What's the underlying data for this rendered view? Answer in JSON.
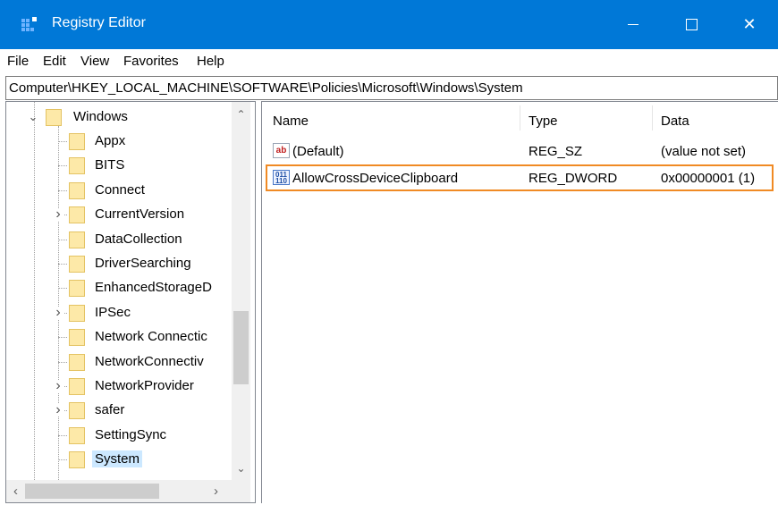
{
  "window": {
    "title": "Registry Editor",
    "accent_color": "#0078d7",
    "icons": [
      "registry-editor-icon",
      "minimize-icon",
      "maximize-icon",
      "close-icon"
    ],
    "close_glyph": "✕"
  },
  "menu": {
    "file": "File",
    "edit": "Edit",
    "view": "View",
    "favorites": "Favorites",
    "help": "Help"
  },
  "address": {
    "path": "Computer\\HKEY_LOCAL_MACHINE\\SOFTWARE\\Policies\\Microsoft\\Windows\\System"
  },
  "tree": {
    "parent": {
      "label": "Windows",
      "expander": "⌄"
    },
    "items": [
      {
        "label": "Appx",
        "expander": ""
      },
      {
        "label": "BITS",
        "expander": ""
      },
      {
        "label": "Connect",
        "expander": ""
      },
      {
        "label": "CurrentVersion",
        "expander": "›"
      },
      {
        "label": "DataCollection",
        "expander": ""
      },
      {
        "label": "DriverSearching",
        "expander": ""
      },
      {
        "label": "EnhancedStorageD",
        "expander": ""
      },
      {
        "label": "IPSec",
        "expander": "›"
      },
      {
        "label": "Network Connectic",
        "expander": ""
      },
      {
        "label": "NetworkConnectiv",
        "expander": ""
      },
      {
        "label": "NetworkProvider",
        "expander": "›"
      },
      {
        "label": "safer",
        "expander": "›"
      },
      {
        "label": "SettingSync",
        "expander": ""
      },
      {
        "label": "System",
        "expander": "",
        "selected": true
      }
    ],
    "selection_color": "#cce8ff",
    "scroll_up_glyph": "⌃",
    "scroll_down_glyph": "⌄",
    "scroll_left_glyph": "‹",
    "scroll_right_glyph": "›"
  },
  "values": {
    "columns": {
      "name": "Name",
      "type": "Type",
      "data": "Data"
    },
    "rows": [
      {
        "name": "(Default)",
        "type": "REG_SZ",
        "data": "(value not set)",
        "icon": "string-value-icon",
        "icon_text": "ab"
      },
      {
        "name": "AllowCrossDeviceClipboard",
        "type": "REG_DWORD",
        "data": "0x00000001 (1)",
        "icon": "dword-value-icon",
        "icon_text": "011 110",
        "highlighted": true
      }
    ],
    "highlight_color": "#f08a24"
  }
}
